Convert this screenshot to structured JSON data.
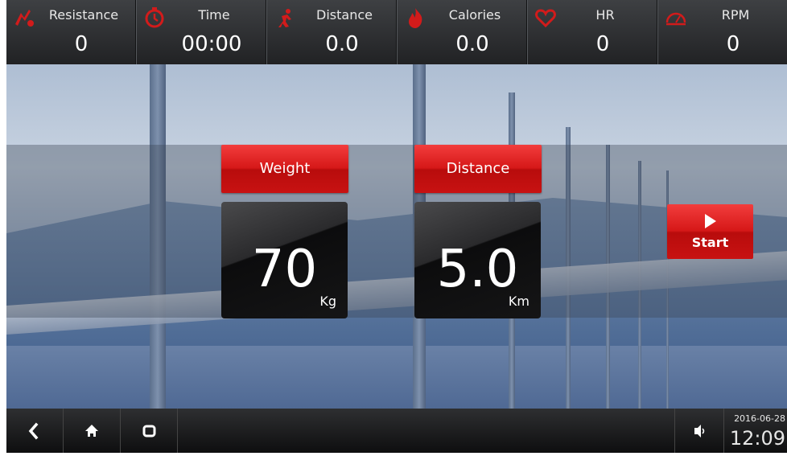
{
  "stats": [
    {
      "label": "Resistance",
      "value": "0",
      "icon": "resistance-icon"
    },
    {
      "label": "Time",
      "value": "00:00",
      "icon": "clock-icon"
    },
    {
      "label": "Distance",
      "value": "0.0",
      "icon": "runner-icon"
    },
    {
      "label": "Calories",
      "value": "0.0",
      "icon": "flame-icon"
    },
    {
      "label": "HR",
      "value": "0",
      "icon": "heart-icon"
    },
    {
      "label": "RPM",
      "value": "0",
      "icon": "speedometer-icon"
    }
  ],
  "weight": {
    "button_label": "Weight",
    "value": "70",
    "unit": "Kg"
  },
  "distance": {
    "button_label": "Distance",
    "value": "5.0",
    "unit": "Km"
  },
  "start": {
    "label": "Start",
    "icon": "play-icon"
  },
  "nav": {
    "back_icon": "back-icon",
    "home_icon": "home-icon",
    "recent_icon": "recent-apps-icon",
    "volume_icon": "volume-icon"
  },
  "clock": {
    "date": "2016-06-28",
    "time": "12:09"
  },
  "colors": {
    "accent_red": "#d61818",
    "bar_dark": "#2a2b2d"
  }
}
